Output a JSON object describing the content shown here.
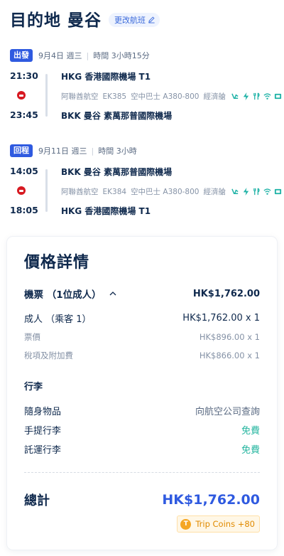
{
  "header": {
    "title": "目的地 曼谷",
    "change_flight": "更改航班"
  },
  "outbound": {
    "badge": "出發",
    "date": "9月4日 週三",
    "duration": "時間 3小時15分",
    "dep_time": "21:30",
    "dep_airport": "HKG 香港國際機場 T1",
    "airline": "阿聯酋航空",
    "flight_no": "EK385",
    "aircraft": "空中巴士 A380-800",
    "cabin": "經濟艙",
    "arr_time": "23:45",
    "arr_airport": "BKK 曼谷 素萬那普國際機場"
  },
  "return": {
    "badge": "回程",
    "date": "9月11日 週三",
    "duration": "時間 3小時",
    "dep_time": "14:05",
    "dep_airport": "BKK 曼谷 素萬那普國際機場",
    "airline": "阿聯酋航空",
    "flight_no": "EK384",
    "aircraft": "空中巴士 A380-800",
    "cabin": "經濟艙",
    "arr_time": "18:05",
    "arr_airport": "HKG 香港國際機場 T1"
  },
  "amenities": [
    "seat-recline-icon",
    "power-icon",
    "meal-icon",
    "wifi-icon",
    "entertainment-icon"
  ],
  "price": {
    "title": "價格詳情",
    "ticket_label": "機票 （1位成人）",
    "ticket_total": "HK$1,762.00",
    "adult_label": "成人 （乘客 1）",
    "adult_value": "HK$1,762.00 x 1",
    "fare_label": "票價",
    "fare_value": "HK$896.00 x 1",
    "tax_label": "稅項及附加費",
    "tax_value": "HK$866.00 x 1",
    "baggage_title": "行李",
    "personal_label": "隨身物品",
    "personal_value": "向航空公司查詢",
    "carryon_label": "手提行李",
    "carryon_value": "免費",
    "checked_label": "託運行李",
    "checked_value": "免費",
    "total_label": "總計",
    "total_value": "HK$1,762.00",
    "coins": "Trip Coins +80",
    "coin_symbol": "T"
  },
  "colors": {
    "accent": "#2f5ae0",
    "free": "#24b59f",
    "amenity": "#1eb2a6",
    "coin": "#f5a623"
  }
}
